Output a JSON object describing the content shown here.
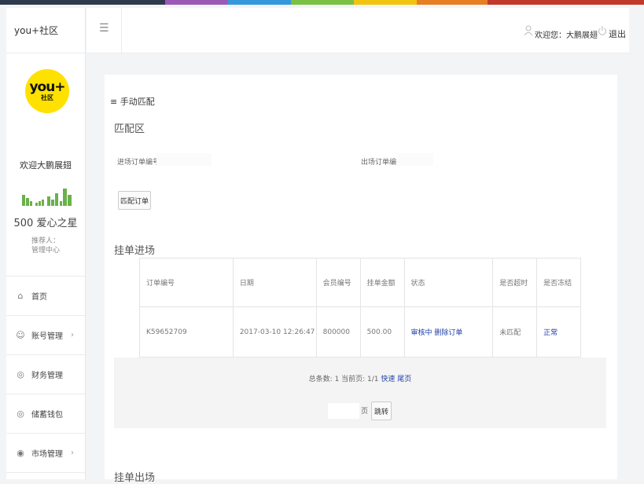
{
  "brand": "you+社区",
  "logo": {
    "main": "you+",
    "sub": "社区"
  },
  "profile": {
    "welcome": "欢迎大鹏展翅",
    "stars": "500 爱心之星",
    "referrer_label": "推荐人：",
    "referrer_value": "管理中心"
  },
  "nav": [
    {
      "label": "首页",
      "icon": "home-icon",
      "glyph": "⌂",
      "has_chevron": false
    },
    {
      "label": "账号管理",
      "icon": "account-icon",
      "glyph": "☺",
      "has_chevron": true
    },
    {
      "label": "财务管理",
      "icon": "finance-icon",
      "glyph": "◎",
      "has_chevron": false
    },
    {
      "label": "储蓄钱包",
      "icon": "wallet-icon",
      "glyph": "◎",
      "has_chevron": false
    },
    {
      "label": "市场管理",
      "icon": "market-icon",
      "glyph": "◉",
      "has_chevron": true
    }
  ],
  "header": {
    "welcome_user": "欢迎您：大鹏展翅",
    "logout": "退出"
  },
  "content": {
    "section_tag": "≡ 手动匹配",
    "match_area_title": "匹配区",
    "entry_order_label": "进场订单编号:",
    "entry_order_value": "",
    "exit_order_label": "出场订单编号:",
    "exit_order_value": "",
    "match_button": "匹配订单",
    "entry_title": "挂单进场",
    "exit_title": "挂单出场"
  },
  "table": {
    "headers": [
      "订单编号",
      "日期",
      "会员编号",
      "挂单金额",
      "状态",
      "是否超时",
      "是否冻结"
    ],
    "rows": [
      {
        "order_no": "K59652709",
        "date": "2017-03-10 12:26:47",
        "member_no": "800000",
        "amount": "500.00",
        "status": "审核中",
        "status_action": "删除订单",
        "timeout": "未匹配",
        "frozen": "正常"
      }
    ]
  },
  "pager": {
    "summary": "总条数: 1 当前页: 1/1",
    "first": "快速",
    "last": "尾页",
    "page_value": "",
    "page_label": "页",
    "go_button": "跳转"
  },
  "colors": {
    "accent_link": "#1f3fa8",
    "logo_yellow": "#ffe100",
    "bar_green": "#6ab04c"
  }
}
